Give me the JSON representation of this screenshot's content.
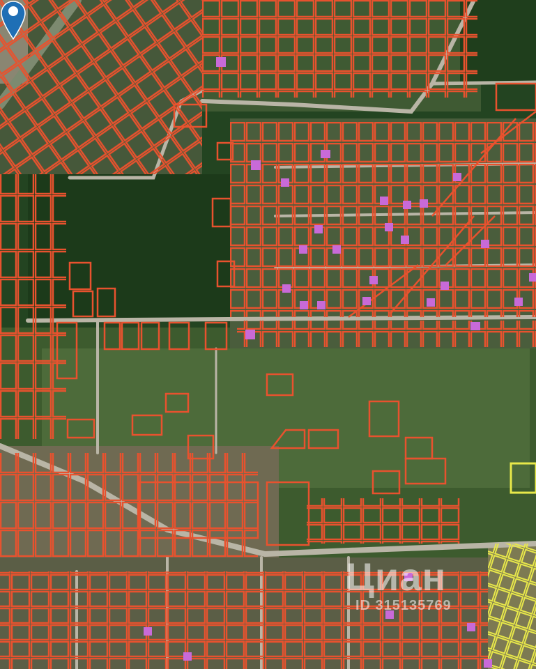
{
  "map": {
    "view": "satellite",
    "colors": {
      "forest": "#1f3f1c",
      "meadow": "#4c6a3a",
      "bare_ground": "#9b8a72",
      "road": "#b9b5a6",
      "parcel_outline": "#e8522e",
      "selected_parcel_outline": "#e8e84a",
      "building_marker": "#c86ad8",
      "pin": "#1f6fb5"
    },
    "pin_icon": "location-pin-icon",
    "watermark": {
      "logo": "Циан",
      "id_text": "ID 315135769"
    }
  }
}
